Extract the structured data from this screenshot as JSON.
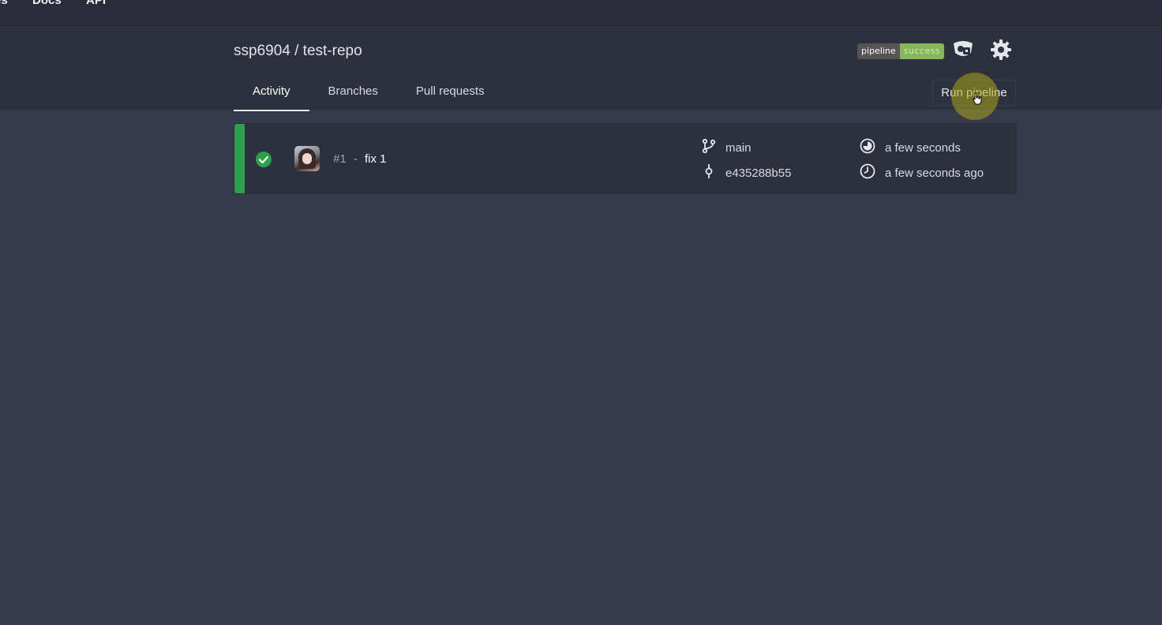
{
  "topnav": {
    "links": [
      {
        "label": "es"
      },
      {
        "label": "Docs"
      },
      {
        "label": "API"
      }
    ]
  },
  "repo": {
    "title": "ssp6904 / test-repo",
    "badge_left": "pipeline",
    "badge_right": "success"
  },
  "tabs": [
    {
      "label": "Activity",
      "active": true
    },
    {
      "label": "Branches",
      "active": false
    },
    {
      "label": "Pull requests",
      "active": false
    }
  ],
  "run_button": {
    "label": "Run pipeline"
  },
  "pipelines": [
    {
      "status": "success",
      "number": "#1",
      "separator": "-",
      "message": "fix 1",
      "branch": "main",
      "commit": "e435288b55",
      "duration": "a few seconds",
      "created": "a few seconds ago"
    }
  ],
  "icons": {
    "status": "check-circle-icon",
    "branch": "git-branch-icon",
    "commit": "git-commit-icon",
    "duration": "timer-icon",
    "created": "clock-icon",
    "secrets": "secret-key-icon",
    "settings": "gear-icon"
  },
  "colors": {
    "success": "#2e9e4f",
    "badge_success": "#86b85a"
  }
}
